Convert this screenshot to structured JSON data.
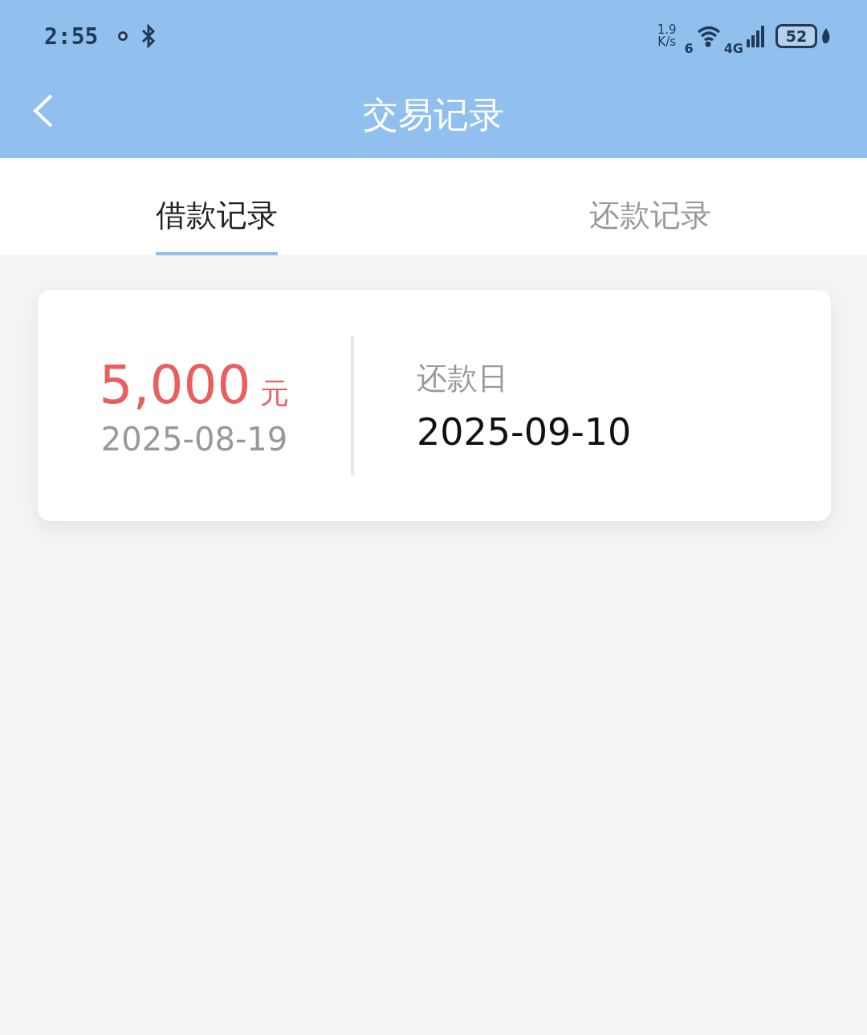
{
  "status_bar": {
    "time": "2:55",
    "net_speed": "1.9",
    "net_unit": "K/s",
    "wifi_label": "6",
    "cell_label": "4G",
    "battery": "52"
  },
  "header": {
    "title": "交易记录"
  },
  "tabs": [
    {
      "label": "借款记录",
      "selected": true
    },
    {
      "label": "还款记录",
      "selected": false
    }
  ],
  "records": [
    {
      "amount": "5,000",
      "unit": "元",
      "date": "2025-08-19",
      "due_label": "还款日",
      "due_date": "2025-09-10"
    }
  ]
}
